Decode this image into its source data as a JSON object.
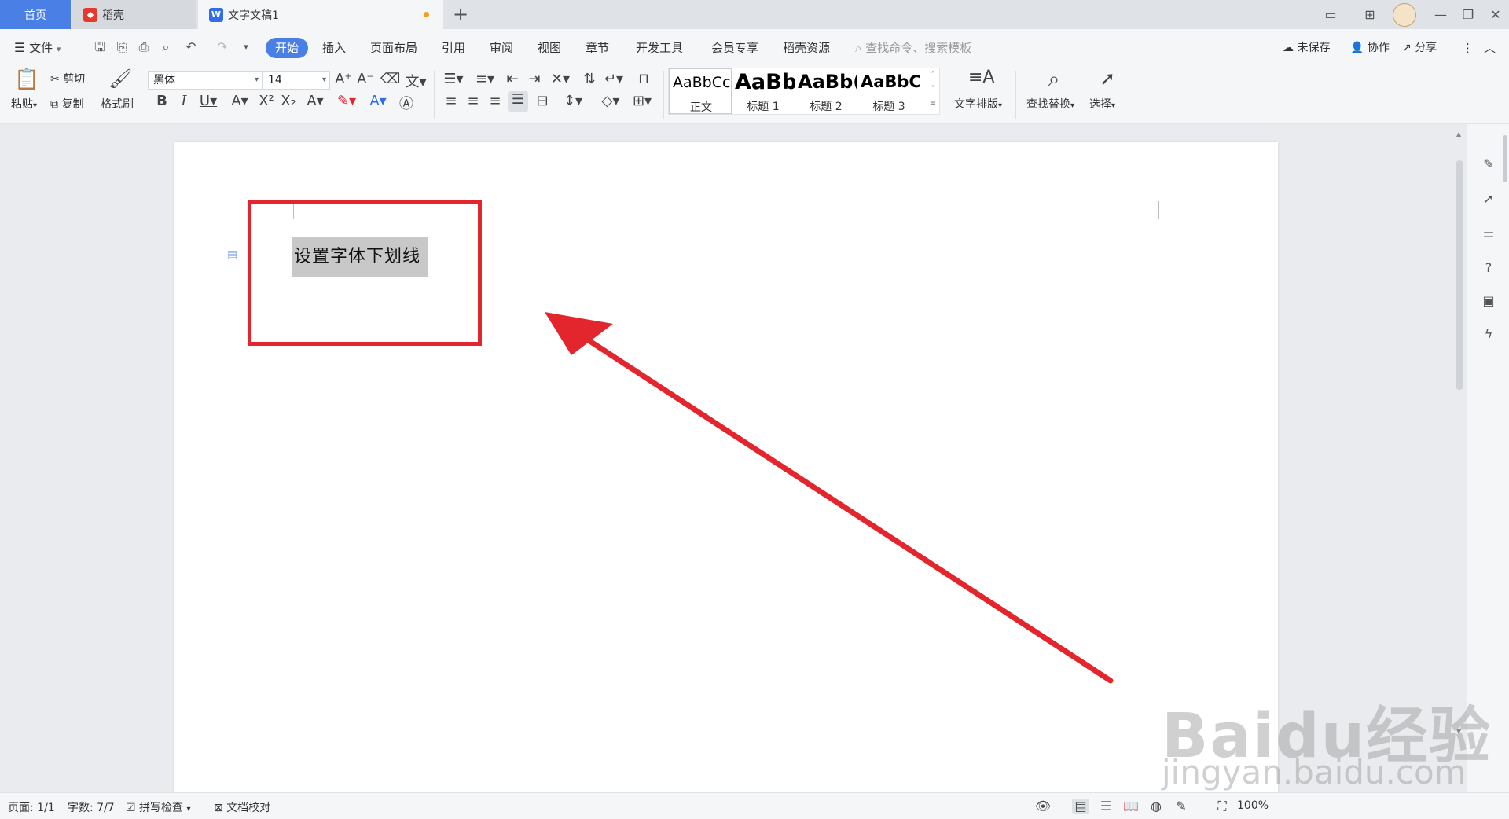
{
  "tabs": {
    "home": "首页",
    "daoke": "稻壳",
    "document": "文字文稿1",
    "add": "+"
  },
  "menu": {
    "file": "文件",
    "items": [
      "开始",
      "插入",
      "页面布局",
      "引用",
      "审阅",
      "视图",
      "章节",
      "开发工具",
      "会员专享",
      "稻壳资源"
    ],
    "search_placeholder": "查找命令、搜索模板",
    "unsaved": "未保存",
    "collaborate": "协作",
    "share": "分享"
  },
  "ribbon": {
    "paste": "粘贴",
    "cut": "剪切",
    "copy": "复制",
    "format_painter": "格式刷",
    "font_name": "黑体",
    "font_size": "14",
    "styles": [
      {
        "sample": "AaBbCcI",
        "label": "正文"
      },
      {
        "sample": "AaBb",
        "label": "标题 1"
      },
      {
        "sample": "AaBb(",
        "label": "标题 2"
      },
      {
        "sample": "AaBbC",
        "label": "标题 3"
      }
    ],
    "text_layout": "文字排版",
    "find_replace": "查找替换",
    "select": "选择"
  },
  "document": {
    "selected_text": "设置字体下划线"
  },
  "status": {
    "page": "页面: 1/1",
    "word_count": "字数: 7/7",
    "spell_check": "拼写检查",
    "proofread": "文档校对",
    "zoom": "100%"
  },
  "watermark": {
    "logo": "Baidu经验",
    "url": "jingyan.baidu.com"
  },
  "colors": {
    "accent": "#4a7fe6",
    "annotation_red": "#e3252d",
    "selection_gray": "#c8c8c8"
  }
}
